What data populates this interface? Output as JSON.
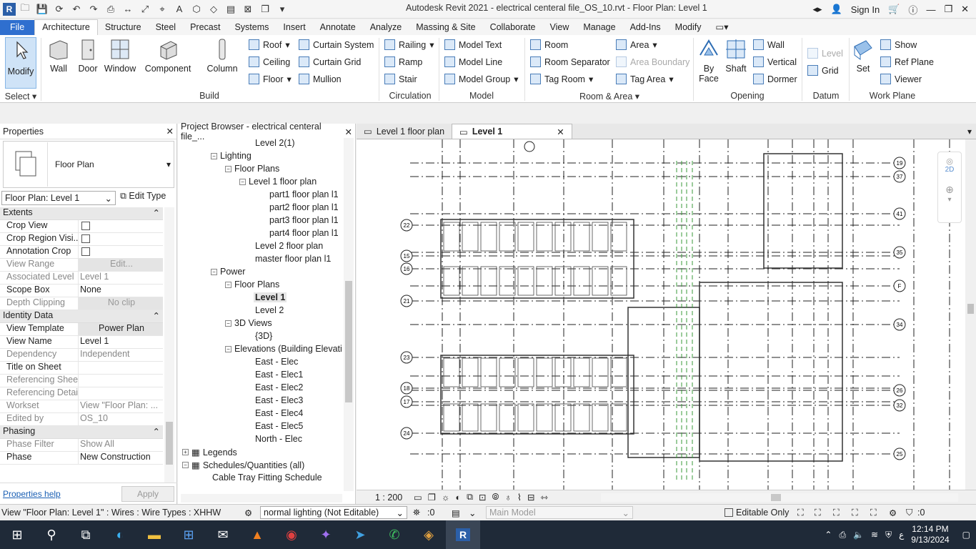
{
  "window": {
    "title": "Autodesk Revit 2021 - electrical centeral file_OS_10.rvt - Floor Plan: Level 1",
    "sign_in": "Sign In"
  },
  "ribbon_tabs": [
    "File",
    "Architecture",
    "Structure",
    "Steel",
    "Precast",
    "Systems",
    "Insert",
    "Annotate",
    "Analyze",
    "Massing & Site",
    "Collaborate",
    "View",
    "Manage",
    "Add-Ins",
    "Modify"
  ],
  "ribbon": {
    "select": {
      "modify": "Modify",
      "label": "Select"
    },
    "build": {
      "wall": "Wall",
      "door": "Door",
      "window": "Window",
      "component": "Component",
      "column": "Column",
      "roof": "Roof",
      "ceiling": "Ceiling",
      "floor": "Floor",
      "curtain_system": "Curtain System",
      "curtain_grid": "Curtain Grid",
      "mullion": "Mullion",
      "label": "Build"
    },
    "circulation": {
      "railing": "Railing",
      "ramp": "Ramp",
      "stair": "Stair",
      "label": "Circulation"
    },
    "model": {
      "model_text": "Model Text",
      "model_line": "Model Line",
      "model_group": "Model Group",
      "label": "Model"
    },
    "room_area": {
      "room": "Room",
      "room_separator": "Room Separator",
      "tag_room": "Tag Room",
      "area": "Area",
      "area_boundary": "Area Boundary",
      "tag_area": "Tag Area",
      "label": "Room & Area"
    },
    "opening": {
      "by_face_1": "By",
      "by_face_2": "Face",
      "shaft": "Shaft",
      "wall": "Wall",
      "vertical": "Vertical",
      "dormer": "Dormer",
      "label": "Opening"
    },
    "datum": {
      "level": "Level",
      "grid": "Grid",
      "label": "Datum"
    },
    "work_plane": {
      "set": "Set",
      "show": "Show",
      "ref_plane": "Ref Plane",
      "viewer": "Viewer",
      "label": "Work Plane"
    }
  },
  "properties": {
    "title": "Properties",
    "type_name": "Floor Plan",
    "type_selector": "Floor Plan: Level 1",
    "edit_type": "Edit Type",
    "categories": {
      "extents": "Extents",
      "identity": "Identity Data",
      "phasing": "Phasing"
    },
    "rows": {
      "crop_view": "Crop View",
      "crop_region": "Crop Region Visi...",
      "annotation_crop": "Annotation Crop",
      "view_range": "View Range",
      "view_range_val": "Edit...",
      "assoc_level": "Associated Level",
      "assoc_level_val": "Level 1",
      "scope_box": "Scope Box",
      "scope_box_val": "None",
      "depth_clip": "Depth Clipping",
      "depth_clip_val": "No clip",
      "view_template": "View Template",
      "view_template_val": "Power Plan",
      "view_name": "View Name",
      "view_name_val": "Level 1",
      "dependency": "Dependency",
      "dependency_val": "Independent",
      "title_on_sheet": "Title on Sheet",
      "ref_sheet": "Referencing Sheet",
      "ref_detail": "Referencing Detail",
      "workset": "Workset",
      "workset_val": "View \"Floor Plan: ...",
      "edited_by": "Edited by",
      "edited_by_val": "OS_10",
      "phase_filter": "Phase Filter",
      "phase_filter_val": "Show All",
      "phase": "Phase",
      "phase_val": "New Construction"
    },
    "help": "Properties help",
    "apply": "Apply"
  },
  "browser": {
    "title": "Project Browser - electrical centeral file_...",
    "items": [
      {
        "label": "Level 2(1)",
        "indent": 0
      },
      {
        "label": "Lighting"
      },
      {
        "label": "Floor Plans"
      },
      {
        "label": "Level 1 floor plan"
      },
      {
        "label": "part1 floor plan l1"
      },
      {
        "label": "part2 floor plan l1"
      },
      {
        "label": "part3 floor plan l1"
      },
      {
        "label": "part4 floor plan l1"
      },
      {
        "label": "Level 2 floor plan"
      },
      {
        "label": "master floor plan l1"
      },
      {
        "label": "Power"
      },
      {
        "label": "Floor Plans"
      },
      {
        "label": "Level 1"
      },
      {
        "label": "Level 2"
      },
      {
        "label": "3D Views"
      },
      {
        "label": "{3D}"
      },
      {
        "label": "Elevations (Building Elevati"
      },
      {
        "label": "East - Elec"
      },
      {
        "label": "East - Elec1"
      },
      {
        "label": "East - Elec2"
      },
      {
        "label": "East - Elec3"
      },
      {
        "label": "East - Elec4"
      },
      {
        "label": "East - Elec5"
      },
      {
        "label": "North - Elec"
      },
      {
        "label": "Legends"
      },
      {
        "label": "Schedules/Quantities (all)"
      },
      {
        "label": "Cable Tray Fitting Schedule"
      }
    ]
  },
  "view_tabs": [
    "Level 1 floor plan",
    "Level 1"
  ],
  "view_control": {
    "scale": "1 : 200"
  },
  "grid_labels": [
    "22",
    "15",
    "16",
    "21",
    "23",
    "18",
    "17",
    "24",
    "19",
    "37",
    "41",
    "35",
    "F",
    "34",
    "26",
    "32",
    "25"
  ],
  "status": {
    "message": "View \"Floor Plan: Level 1\" : Wires : Wire Types : XHHW",
    "workset": "normal lighting (Not Editable)",
    "count1": ":0",
    "main_model": "Main Model",
    "editable_only": "Editable Only",
    "count2": ":0"
  },
  "taskbar": {
    "time": "12:14 PM",
    "date": "9/13/2024",
    "lang": "ع"
  }
}
